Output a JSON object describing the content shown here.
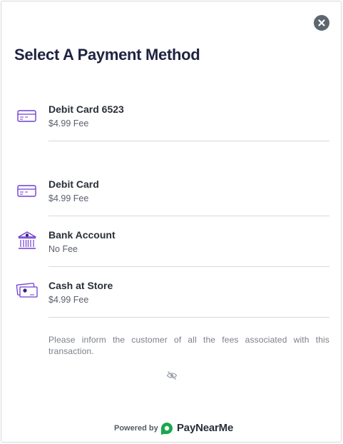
{
  "modal": {
    "title": "Select A Payment Method",
    "close_icon": "close-icon"
  },
  "options": [
    {
      "name": "Debit Card 6523",
      "fee": "$4.99 Fee",
      "icon": "credit-card-icon"
    },
    {
      "name": "Debit Card",
      "fee": "$4.99 Fee",
      "icon": "credit-card-icon"
    },
    {
      "name": "Bank Account",
      "fee": "No Fee",
      "icon": "bank-icon"
    },
    {
      "name": "Cash at Store",
      "fee": "$4.99 Fee",
      "icon": "cash-icon"
    }
  ],
  "notice": "Please inform the customer of all the fees associated with this transaction.",
  "eye_icon": "eye-off-icon",
  "footer": {
    "powered_by": "Powered by",
    "brand": "PayNearMe"
  },
  "colors": {
    "accent": "#6f3fd1",
    "title": "#1d2340",
    "brand_green": "#1aa84f",
    "close_bg": "#5e6670"
  }
}
